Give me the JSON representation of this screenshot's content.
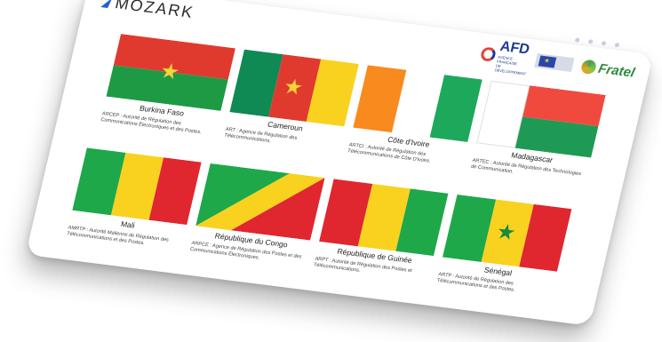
{
  "brand": {
    "name": "MOZARK"
  },
  "partners": {
    "afd": "AFD",
    "afd_sub": "AGENCE FRANÇAISE DE DÉVELOPPEMENT",
    "fratel": "Fratel"
  },
  "colors": {
    "accent": "#1f5fd8",
    "afd_red": "#e2443a",
    "afd_blue": "#1d3a8f",
    "fratel_green": "#2e8b3d"
  },
  "countries": [
    {
      "name": "Burkina Faso",
      "desc": "ARCEP : Autorité de Régulation des Communications Électroniques et des Postes."
    },
    {
      "name": "Cameroun",
      "desc": "ART : Agence de Régulation des Télécommunications."
    },
    {
      "name": "Côte d'Ivoire",
      "desc": "ARTCI : Autorité de Régulation des Télécommunications de Côte D'ivoire."
    },
    {
      "name": "Madagascar",
      "desc": "ARTEC : Autorité de Régulation des Technologies de Communication."
    },
    {
      "name": "Mali",
      "desc": "AMRTP : Autorité Malienne de Régulation des Télécommunications et des Postes."
    },
    {
      "name": "République du Congo",
      "desc": "ARPCE : Agence de Régulation des Postes et des Communications Électroniques."
    },
    {
      "name": "République de Guinée",
      "desc": "ARPT : Autorité de Régulation des Postes et Télécommunications."
    },
    {
      "name": "Sénégal",
      "desc": "ARTP : Autorité de Régulation des Télécommunications et des Postes."
    }
  ]
}
